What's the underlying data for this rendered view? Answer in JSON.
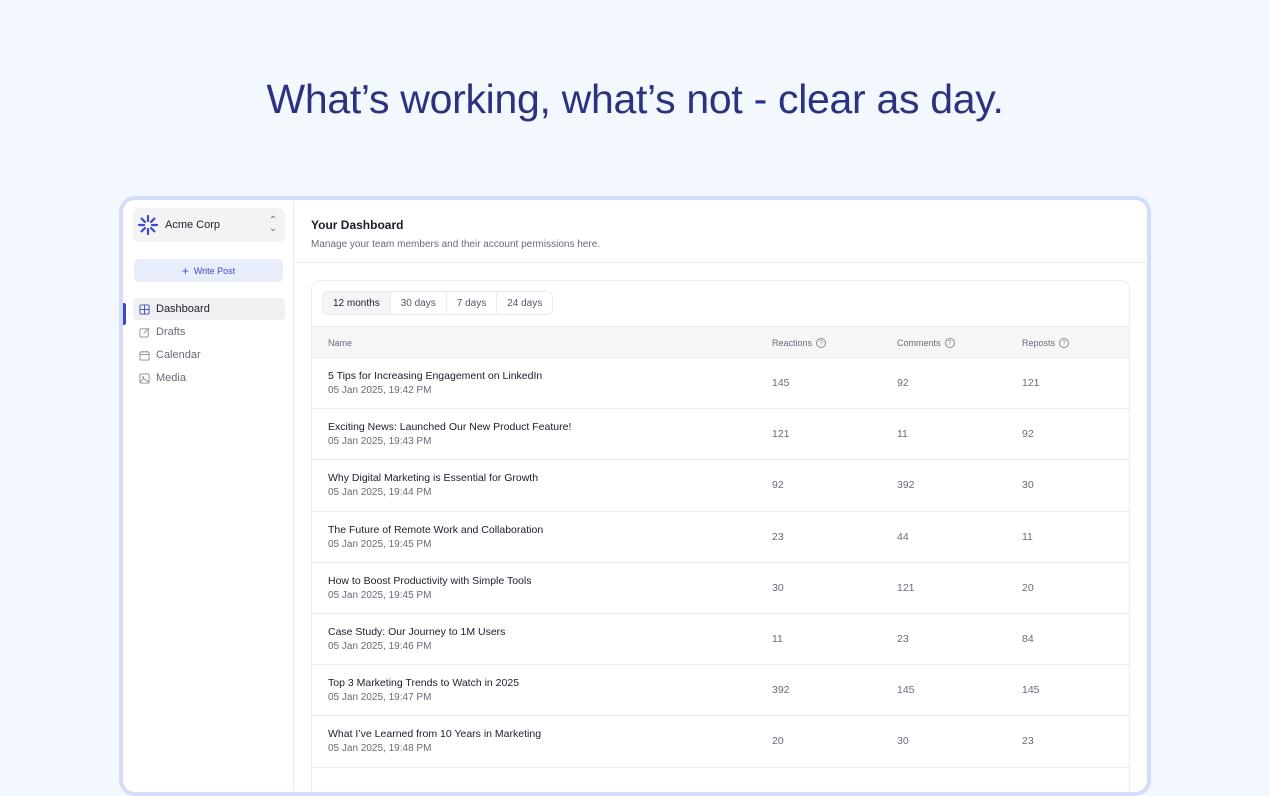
{
  "hero": {
    "headline": "What’s working, what’s not - clear as day."
  },
  "sidebar": {
    "org_name": "Acme Corp",
    "write_post_label": "Write Post",
    "items": [
      {
        "label": "Dashboard",
        "icon": "grid-icon",
        "active": true
      },
      {
        "label": "Drafts",
        "icon": "edit-icon",
        "active": false
      },
      {
        "label": "Calendar",
        "icon": "calendar-icon",
        "active": false
      },
      {
        "label": "Media",
        "icon": "image-icon",
        "active": false
      }
    ]
  },
  "main": {
    "title": "Your Dashboard",
    "subtitle": "Manage your team members and their account permissions here."
  },
  "tabs": [
    {
      "label": "12 months",
      "active": true
    },
    {
      "label": "30 days",
      "active": false
    },
    {
      "label": "7 days",
      "active": false
    },
    {
      "label": "24 days",
      "active": false
    }
  ],
  "table": {
    "headers": {
      "name": "Name",
      "reactions": "Reactions",
      "comments": "Comments",
      "reposts": "Reposts"
    },
    "rows": [
      {
        "title": "5 Tips for Increasing Engagement on LinkedIn",
        "date": "05 Jan 2025, 19:42 PM",
        "reactions": "145",
        "comments": "92",
        "reposts": "121"
      },
      {
        "title": "Exciting News: Launched Our New Product Feature!",
        "date": "05 Jan 2025, 19:43 PM",
        "reactions": "121",
        "comments": "11",
        "reposts": "92"
      },
      {
        "title": "Why Digital Marketing is Essential for Growth",
        "date": "05 Jan 2025, 19:44 PM",
        "reactions": "92",
        "comments": "392",
        "reposts": "30"
      },
      {
        "title": "The Future of Remote Work and Collaboration",
        "date": "05 Jan 2025, 19:45 PM",
        "reactions": "23",
        "comments": "44",
        "reposts": "11"
      },
      {
        "title": "How to Boost Productivity with Simple Tools",
        "date": "05 Jan 2025, 19:45 PM",
        "reactions": "30",
        "comments": "121",
        "reposts": "20"
      },
      {
        "title": "Case Study: Our Journey to 1M Users",
        "date": "05 Jan 2025, 19:46 PM",
        "reactions": "11",
        "comments": "23",
        "reposts": "84"
      },
      {
        "title": "Top 3 Marketing Trends to Watch in 2025",
        "date": "05 Jan 2025, 19:47 PM",
        "reactions": "392",
        "comments": "145",
        "reposts": "145"
      },
      {
        "title": "What I’ve Learned from 10 Years in Marketing",
        "date": "05 Jan 2025, 19:48 PM",
        "reactions": "20",
        "comments": "30",
        "reposts": "23"
      }
    ]
  },
  "colors": {
    "accent": "#3b4ac8",
    "headline": "#2b3280",
    "frame": "#d3dcfb"
  }
}
